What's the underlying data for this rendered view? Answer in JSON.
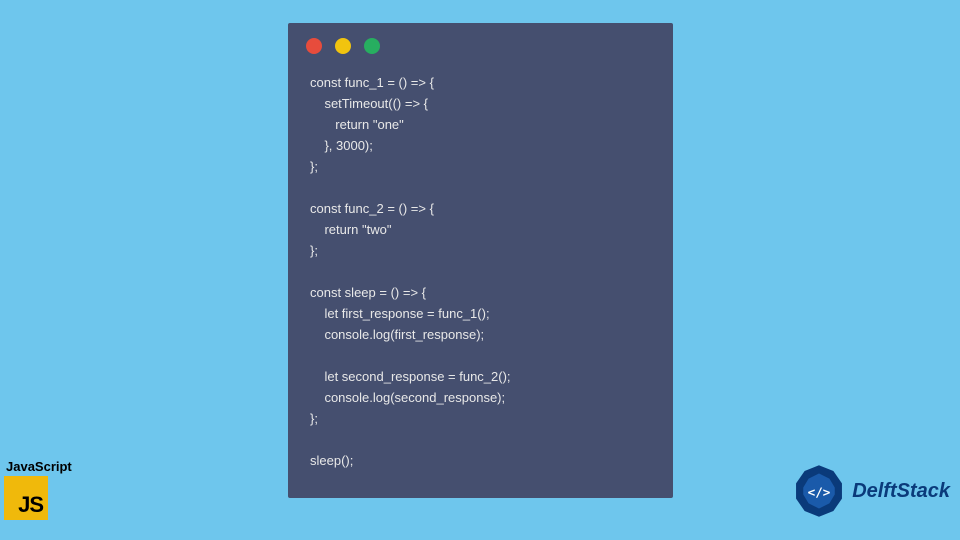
{
  "colors": {
    "background": "#6ec6ed",
    "window_bg": "#454f6f",
    "dot_red": "#e74c3c",
    "dot_yellow": "#f1c40f",
    "dot_green": "#27ae60",
    "code_text": "#e8e8e8",
    "js_icon_bg": "#f0b90b",
    "delft_blue": "#0a3a7a"
  },
  "code": "const func_1 = () => {\n    setTimeout(() => {\n       return \"one\"\n    }, 3000);\n};\n\nconst func_2 = () => {\n    return \"two\"\n};\n\nconst sleep = () => {\n    let first_response = func_1();\n    console.log(first_response);\n\n    let second_response = func_2();\n    console.log(second_response);\n};\n\nsleep();",
  "js_badge": {
    "label": "JavaScript",
    "icon_text": "JS"
  },
  "delft_badge": {
    "text": "DelftStack"
  }
}
